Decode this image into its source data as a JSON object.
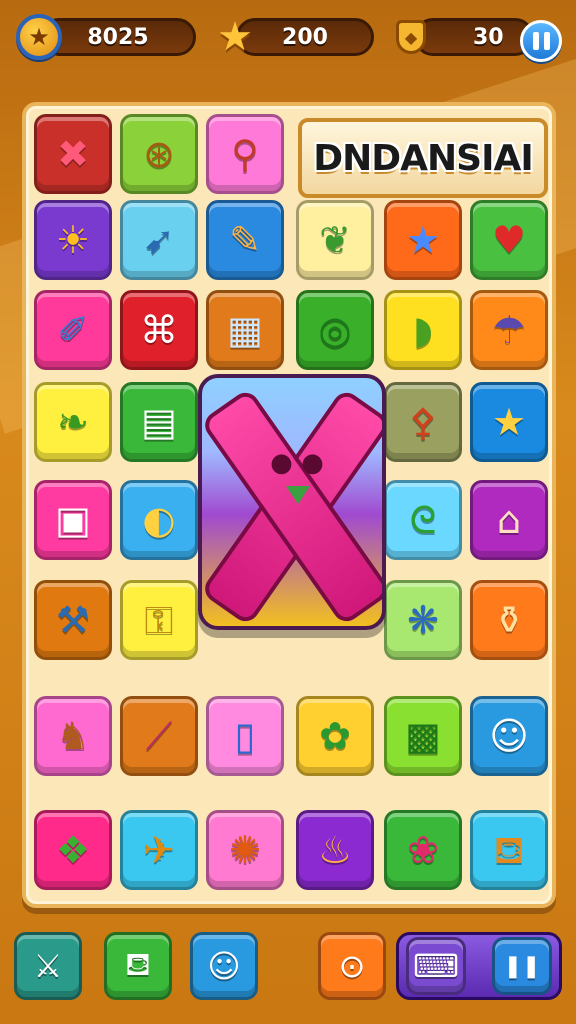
{
  "hud": {
    "coins": "8025",
    "stars": "200",
    "moves": "30",
    "icons": [
      "coin-icon",
      "star-icon",
      "shield-icon",
      "pause-icon"
    ]
  },
  "board": {
    "title": "DNDANSIAI",
    "tiles": [
      {
        "icon": "✖",
        "color": "#c9302a",
        "fg": "#ff5a7a"
      },
      {
        "icon": "⊛",
        "color": "#8bd23a",
        "fg": "#a85a10"
      },
      {
        "icon": "⚲",
        "color": "#ff7ad8",
        "fg": "#c03a2a"
      },
      {
        "icon": "☀",
        "color": "#7a3ad0",
        "fg": "#ffc020"
      },
      {
        "icon": "➹",
        "color": "#6ad0f0",
        "fg": "#2a6ab0"
      },
      {
        "icon": "✎",
        "color": "#2a8ae0",
        "fg": "#ffb040"
      },
      {
        "icon": "❦",
        "color": "#fff0a0",
        "fg": "#3a9a30"
      },
      {
        "icon": "★",
        "color": "#ff6a1a",
        "fg": "#4a8aff"
      },
      {
        "icon": "♥",
        "color": "#4ac040",
        "fg": "#e02a2a"
      },
      {
        "icon": "✐",
        "color": "#ff3a9a",
        "fg": "#3a7ad0"
      },
      {
        "icon": "⌘",
        "color": "#e0202a",
        "fg": "#ffffff"
      },
      {
        "icon": "▦",
        "color": "#e07a1a",
        "fg": "#cfe8ff"
      },
      {
        "icon": "◎",
        "color": "#3ab02a",
        "fg": "#1a7a1a"
      },
      {
        "icon": "◗",
        "color": "#ffe020",
        "fg": "#4aa020"
      },
      {
        "icon": "☂",
        "color": "#ff8a1a",
        "fg": "#5a4ab0"
      },
      {
        "icon": "❧",
        "color": "#fff040",
        "fg": "#3a9a20"
      },
      {
        "icon": "▤",
        "color": "#3ab83a",
        "fg": "#ffffff"
      },
      {
        "icon": "⚴",
        "color": "#9aa060",
        "fg": "#d0401a"
      },
      {
        "icon": "★",
        "color": "#1a8ae0",
        "fg": "#ffd040"
      },
      {
        "icon": "▣",
        "color": "#ff3aa0",
        "fg": "#ffffff"
      },
      {
        "icon": "◐",
        "color": "#3ab0f0",
        "fg": "#ffd040"
      },
      {
        "icon": "ᘓ",
        "color": "#6ad8ff",
        "fg": "#2aa030"
      },
      {
        "icon": "⌂",
        "color": "#b02ac0",
        "fg": "#ffe0c0"
      },
      {
        "icon": "⚒",
        "color": "#e07a10",
        "fg": "#2a6ab0"
      },
      {
        "icon": "⚿",
        "color": "#fff040",
        "fg": "#c08a10"
      },
      {
        "icon": "❋",
        "color": "#a8e870",
        "fg": "#2a6ac0"
      },
      {
        "icon": "⚱",
        "color": "#ff7a1a",
        "fg": "#ffe0a0"
      },
      {
        "icon": "♞",
        "color": "#ff6ad0",
        "fg": "#b05a20"
      },
      {
        "icon": "⟋",
        "color": "#e07a1a",
        "fg": "#c02a6a"
      },
      {
        "icon": "▯",
        "color": "#ff8ae0",
        "fg": "#2a6ad0"
      },
      {
        "icon": "✿",
        "color": "#ffd030",
        "fg": "#2a9a30"
      },
      {
        "icon": "▩",
        "color": "#8ae030",
        "fg": "#1a7a1a"
      },
      {
        "icon": "☺",
        "color": "#2a9ae0",
        "fg": "#ffffff"
      },
      {
        "icon": "❖",
        "color": "#ff2a8a",
        "fg": "#3ab030"
      },
      {
        "icon": "✈",
        "color": "#3ac8f0",
        "fg": "#e08a10"
      },
      {
        "icon": "✺",
        "color": "#ff7ad0",
        "fg": "#e05a10"
      },
      {
        "icon": "♨",
        "color": "#8a2ad0",
        "fg": "#ffb040"
      },
      {
        "icon": "❀",
        "color": "#3ab83a",
        "fg": "#e02a6a"
      },
      {
        "icon": "⛾",
        "color": "#3ac8f0",
        "fg": "#e08a20"
      }
    ]
  },
  "toolbar": {
    "buttons": [
      {
        "name": "crossed-swords-icon",
        "icon": "⚔",
        "color": "#2a9a8a"
      },
      {
        "name": "bucket-icon",
        "icon": "⛾",
        "color": "#3ab83a"
      },
      {
        "name": "creature-icon",
        "icon": "☺",
        "color": "#2a9ae0"
      },
      {
        "name": "eyes-icon",
        "icon": "⊙",
        "color": "#ff7a1a"
      },
      {
        "name": "gamepad-icon",
        "icon": "⌨",
        "color": "#7a4ad0"
      },
      {
        "name": "pause-icon",
        "icon": "❚❚",
        "color": "#2a8ae0"
      }
    ]
  }
}
